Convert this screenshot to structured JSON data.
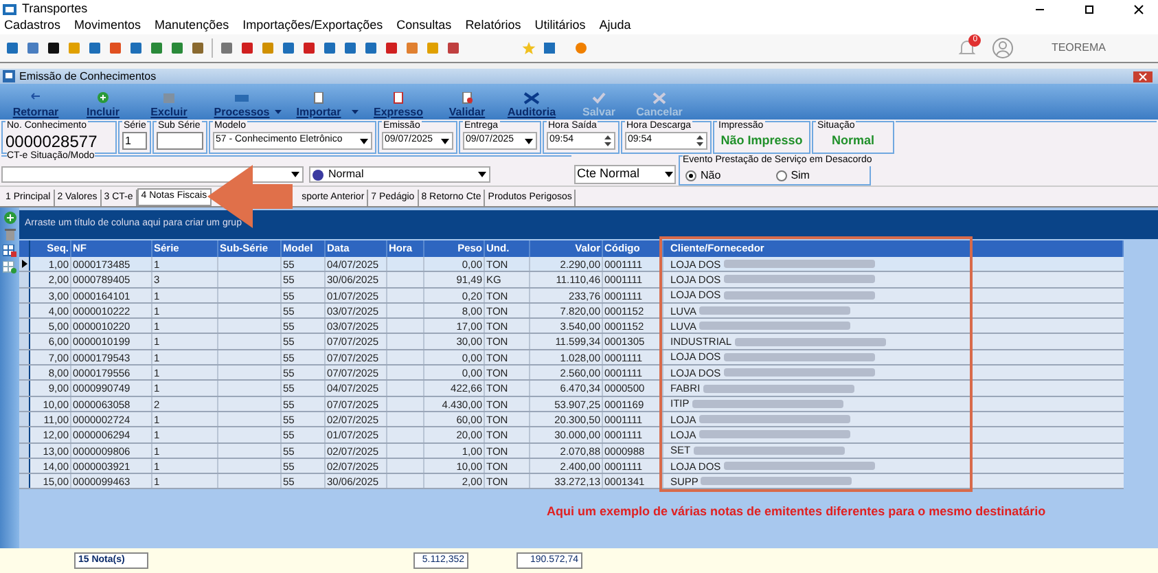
{
  "window": {
    "title": "Transportes"
  },
  "menu": [
    "Cadastros",
    "Movimentos",
    "Manutenções",
    "Importações/Exportações",
    "Consultas",
    "Relatórios",
    "Utilitários",
    "Ajuda"
  ],
  "user": {
    "notifications": "0",
    "name": "TEOREMA"
  },
  "form_window": {
    "title": "Emissão de Conhecimentos"
  },
  "actions": [
    {
      "label": "Retornar",
      "disabled": false,
      "dropdown": false
    },
    {
      "label": "Incluir",
      "disabled": false,
      "dropdown": false
    },
    {
      "label": "Excluir",
      "disabled": false,
      "dropdown": false
    },
    {
      "label": "Processos",
      "disabled": false,
      "dropdown": true
    },
    {
      "label": "Importar",
      "disabled": false,
      "dropdown": true
    },
    {
      "label": "Expresso",
      "disabled": false,
      "dropdown": false
    },
    {
      "label": "Validar",
      "disabled": false,
      "dropdown": false
    },
    {
      "label": "Auditoria",
      "disabled": false,
      "dropdown": false
    },
    {
      "label": "Salvar",
      "disabled": true,
      "dropdown": false
    },
    {
      "label": "Cancelar",
      "disabled": true,
      "dropdown": false
    }
  ],
  "header_fields": [
    {
      "kind": "big",
      "label": "No. Conhecimento",
      "value": "0000028577"
    },
    {
      "kind": "input",
      "label": "Série",
      "value": "1"
    },
    {
      "kind": "input",
      "label": "Sub Série"
    },
    {
      "kind": "select",
      "label": "Modelo",
      "value": "57 - Conhecimento Eletrônico"
    },
    {
      "kind": "select",
      "label": "Emissão",
      "value": "09/07/2025"
    },
    {
      "kind": "select",
      "label": "Entrega",
      "value": "09/07/2025"
    },
    {
      "kind": "spin",
      "label": "Hora Saída",
      "value": "09:54"
    },
    {
      "kind": "spin",
      "label": "Hora Descarga",
      "value": "09:54"
    },
    {
      "kind": "status",
      "label": "Impressão",
      "value": "Não Impresso"
    },
    {
      "kind": "status",
      "label": "Situação",
      "value": "Normal"
    }
  ],
  "cte_situacao": {
    "label": "CT-e Situação/Modo",
    "mode": "Normal",
    "type": "Cte Normal"
  },
  "evento": {
    "label": "Evento Prestação de Serviço em Desacordo",
    "options": [
      {
        "label": "Não",
        "selected": true
      },
      {
        "label": "Sim",
        "selected": false
      }
    ]
  },
  "tabs": [
    {
      "label": "1 Principal",
      "selected": false
    },
    {
      "label": "2 Valores",
      "selected": false
    },
    {
      "label": "3 CT-e",
      "selected": false
    },
    {
      "label": "4 Notas Fiscais",
      "selected": true
    },
    {
      "label": "sporte Anterior",
      "selected": false
    },
    {
      "label": "7 Pedágio",
      "selected": false
    },
    {
      "label": "8 Retorno Cte",
      "selected": false
    },
    {
      "label": "Produtos Perigosos",
      "selected": false
    }
  ],
  "group_panel": "Arraste um título de coluna aqui para criar um grup",
  "table": {
    "columns": [
      "Seq.",
      "NF",
      "Série",
      "Sub-Série",
      "Model",
      "Data",
      "Hora",
      "Peso",
      "Und.",
      "Valor",
      "Código",
      "Cliente/Fornecedor"
    ],
    "rows": [
      {
        "selected": true,
        "cells": [
          "1,00",
          "0000173485",
          "1",
          "",
          "55",
          "04/07/2025",
          "",
          "0,00",
          "TON",
          "2.290,00",
          "0001111"
        ],
        "client": "LOJA DOS",
        "blurred": true
      },
      {
        "selected": false,
        "cells": [
          "2,00",
          "0000789405",
          "3",
          "",
          "55",
          "30/06/2025",
          "",
          "91,49",
          "KG",
          "11.110,46",
          "0001111"
        ],
        "client": "LOJA DOS",
        "blurred": true
      },
      {
        "selected": false,
        "cells": [
          "3,00",
          "0000164101",
          "1",
          "",
          "55",
          "01/07/2025",
          "",
          "0,20",
          "TON",
          "233,76",
          "0001111"
        ],
        "client": "LOJA DOS",
        "blurred": true
      },
      {
        "selected": false,
        "cells": [
          "4,00",
          "0000010222",
          "1",
          "",
          "55",
          "03/07/2025",
          "",
          "8,00",
          "TON",
          "7.820,00",
          "0001152"
        ],
        "client": "LUVA",
        "blurred": true
      },
      {
        "selected": false,
        "cells": [
          "5,00",
          "0000010220",
          "1",
          "",
          "55",
          "03/07/2025",
          "",
          "17,00",
          "TON",
          "3.540,00",
          "0001152"
        ],
        "client": "LUVA",
        "blurred": true
      },
      {
        "selected": false,
        "cells": [
          "6,00",
          "0000010199",
          "1",
          "",
          "55",
          "07/07/2025",
          "",
          "30,00",
          "TON",
          "11.599,34",
          "0001305"
        ],
        "client": "INDUSTRIAL",
        "blurred": true
      },
      {
        "selected": false,
        "cells": [
          "7,00",
          "0000179543",
          "1",
          "",
          "55",
          "07/07/2025",
          "",
          "0,00",
          "TON",
          "1.028,00",
          "0001111"
        ],
        "client": "LOJA DOS",
        "blurred": true
      },
      {
        "selected": false,
        "cells": [
          "8,00",
          "0000179556",
          "1",
          "",
          "55",
          "07/07/2025",
          "",
          "0,00",
          "TON",
          "2.560,00",
          "0001111"
        ],
        "client": "LOJA DOS",
        "blurred": true
      },
      {
        "selected": false,
        "cells": [
          "9,00",
          "0000990749",
          "1",
          "",
          "55",
          "04/07/2025",
          "",
          "422,66",
          "TON",
          "6.470,34",
          "0000500"
        ],
        "client": "FABRI",
        "blurred": true
      },
      {
        "selected": false,
        "cells": [
          "10,00",
          "0000063058",
          "2",
          "",
          "55",
          "07/07/2025",
          "",
          "4.430,00",
          "TON",
          "53.907,25",
          "0001169"
        ],
        "client": "ITIP",
        "blurred": true
      },
      {
        "selected": false,
        "cells": [
          "11,00",
          "0000002724",
          "1",
          "",
          "55",
          "02/07/2025",
          "",
          "60,00",
          "TON",
          "20.300,50",
          "0001111"
        ],
        "client": "LOJA",
        "blurred": true
      },
      {
        "selected": false,
        "cells": [
          "12,00",
          "0000006294",
          "1",
          "",
          "55",
          "01/07/2025",
          "",
          "20,00",
          "TON",
          "30.000,00",
          "0001111"
        ],
        "client": "LOJA",
        "blurred": true
      },
      {
        "selected": false,
        "cells": [
          "13,00",
          "0000009806",
          "1",
          "",
          "55",
          "02/07/2025",
          "",
          "1,00",
          "TON",
          "2.070,88",
          "0000988"
        ],
        "client": "SET",
        "blurred": true
      },
      {
        "selected": false,
        "cells": [
          "14,00",
          "0000003921",
          "1",
          "",
          "55",
          "02/07/2025",
          "",
          "10,00",
          "TON",
          "2.400,00",
          "0001111"
        ],
        "client": "LOJA DOS",
        "blurred": true
      },
      {
        "selected": false,
        "cells": [
          "15,00",
          "0000099463",
          "1",
          "",
          "55",
          "30/06/2025",
          "",
          "2,00",
          "TON",
          "33.272,13",
          "0001341"
        ],
        "client": "SUPP",
        "blurred": true
      }
    ]
  },
  "footer": {
    "count": "15 Nota(s)",
    "peso": "5.112,352",
    "valor": "190.572,74"
  },
  "annotation": "Aqui um exemplo de várias notas de emitentes diferentes para o mesmo destinatário"
}
